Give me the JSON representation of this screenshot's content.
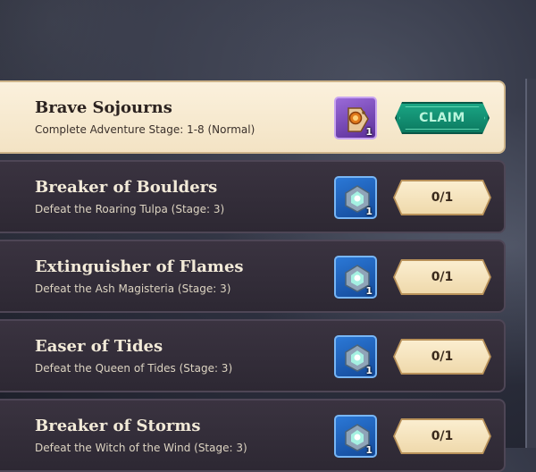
{
  "quests": [
    {
      "title": "Brave Sojourns",
      "description": "Complete Adventure Stage: 1-8 (Normal)",
      "reward_icon": "coin-tag-icon",
      "reward_count": "1",
      "action": "CLAIM",
      "highlighted": true
    },
    {
      "title": "Breaker of Boulders",
      "description": "Defeat the Roaring Tulpa (Stage: 3)",
      "reward_icon": "crystal-gem-icon",
      "reward_count": "1",
      "action": "0/1",
      "highlighted": false
    },
    {
      "title": "Extinguisher of Flames",
      "description": "Defeat the Ash Magisteria (Stage: 3)",
      "reward_icon": "crystal-gem-icon",
      "reward_count": "1",
      "action": "0/1",
      "highlighted": false
    },
    {
      "title": "Easer of Tides",
      "description": "Defeat the Queen of Tides (Stage: 3)",
      "reward_icon": "crystal-gem-icon",
      "reward_count": "1",
      "action": "0/1",
      "highlighted": false
    },
    {
      "title": "Breaker of Storms",
      "description": "Defeat the Witch of the Wind (Stage: 3)",
      "reward_icon": "crystal-gem-icon",
      "reward_count": "1",
      "action": "0/1",
      "highlighted": false
    }
  ],
  "colors": {
    "claim_green": "#0c7a60",
    "highlight_card": "#f6e8cc",
    "dark_card": "#332d39",
    "progress_button": "#f3e0b8"
  }
}
